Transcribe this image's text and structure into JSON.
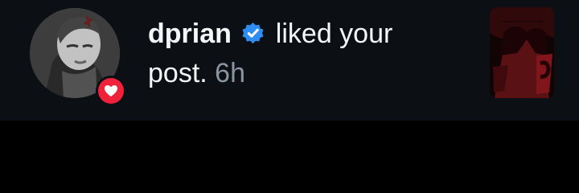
{
  "notification": {
    "username": "dprian",
    "action": " liked your post.",
    "time": "6h",
    "avatar_icon": "user-avatar",
    "badge_icon": "heart-icon",
    "verified_icon": "verified-check-icon",
    "colors": {
      "background": "#0c0f14",
      "text": "#f5f6f8",
      "muted": "#8b95a1",
      "heart": "#f0213a",
      "verified": "#2f8cf0"
    }
  }
}
